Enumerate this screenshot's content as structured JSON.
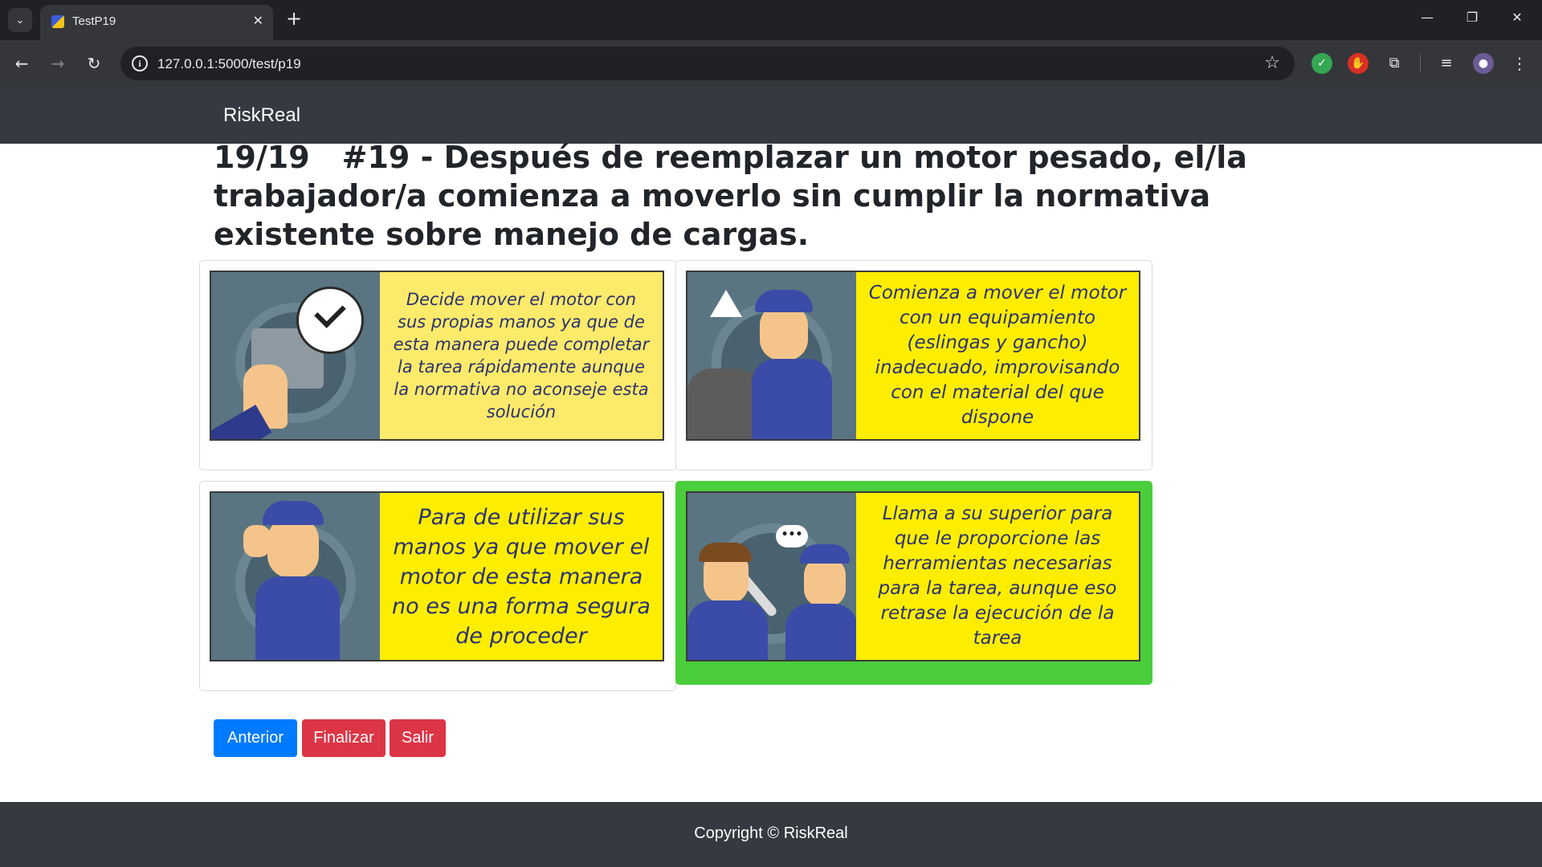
{
  "browser": {
    "tab_title": "TestP19",
    "url": "127.0.0.1:5000/test/p19"
  },
  "site": {
    "brand": "RiskReal"
  },
  "question": {
    "counter": "19/19",
    "text": "#19 - Después de reemplazar un motor pesado, el/la trabajador/a comienza a moverlo sin cumplir la normativa existente sobre manejo de cargas."
  },
  "options": [
    {
      "text": "Decide mover el motor con sus propias manos ya que de esta manera puede completar la tarea rápidamente aunque la normativa no aconseje esta solución",
      "selected": false
    },
    {
      "text": "Comienza a mover el motor con un equipamiento (eslingas y gancho) inadecuado, improvisando con el material del que dispone",
      "selected": false
    },
    {
      "text": "Para de utilizar sus manos ya que mover el motor de esta manera no es una forma segura de proceder",
      "selected": false
    },
    {
      "text": "Llama a su superior para que le proporcione las herramientas necesarias para la tarea, aunque eso retrase la ejecución de la tarea",
      "selected": true
    }
  ],
  "buttons": {
    "previous": "Anterior",
    "finish": "Finalizar",
    "exit": "Salir"
  },
  "footer": {
    "copyright": "Copyright © RiskReal"
  },
  "colors": {
    "selected_border": "#4bce3c",
    "option_text_bg": "#fdee00",
    "option_text_color": "#2c3270",
    "navbar_bg": "#343a40"
  }
}
